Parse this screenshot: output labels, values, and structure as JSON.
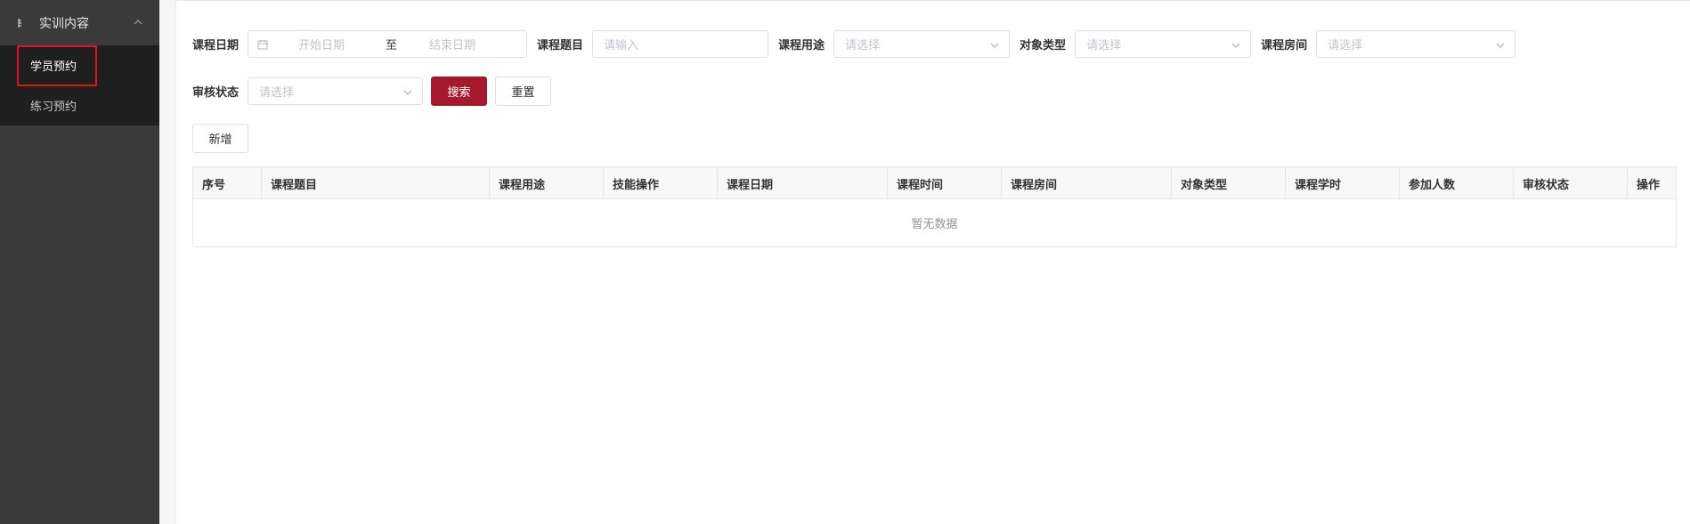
{
  "sidebar": {
    "group_label": "实训内容",
    "items": [
      {
        "label": "学员预约",
        "active": true
      },
      {
        "label": "练习预约",
        "active": false
      }
    ]
  },
  "filters": {
    "course_date_label": "课程日期",
    "start_placeholder": "开始日期",
    "range_separator": "至",
    "end_placeholder": "结束日期",
    "course_title_label": "课程题目",
    "course_title_placeholder": "请输入",
    "course_use_label": "课程用途",
    "course_use_placeholder": "请选择",
    "target_type_label": "对象类型",
    "target_type_placeholder": "请选择",
    "course_room_label": "课程房间",
    "course_room_placeholder": "请选择",
    "review_status_label": "审核状态",
    "review_status_placeholder": "请选择",
    "search_label": "搜索",
    "reset_label": "重置"
  },
  "toolbar": {
    "add_label": "新增"
  },
  "table": {
    "columns": [
      "序号",
      "课程题目",
      "课程用途",
      "技能操作",
      "课程日期",
      "课程时间",
      "课程房间",
      "对象类型",
      "课程学时",
      "参加人数",
      "审核状态",
      "操作"
    ],
    "empty_text": "暂无数据"
  },
  "colors": {
    "sidebar_bg": "#3a3a3a",
    "submenu_bg": "#1f1f1f",
    "primary": "#a5192d",
    "highlight": "#e0141e"
  }
}
